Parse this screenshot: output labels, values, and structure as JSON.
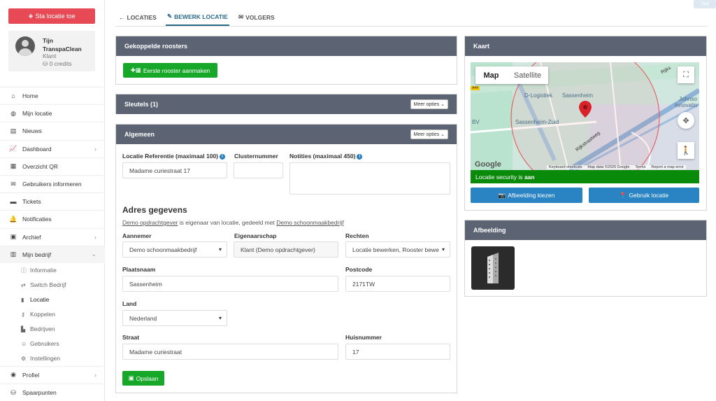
{
  "sidebar": {
    "add_button": "Sta locatie toe",
    "profile": {
      "name": "Tijn TranspaClean",
      "role": "Klant",
      "credits": "0 credits"
    },
    "items": [
      {
        "label": "Home",
        "icon": "home-icon"
      },
      {
        "label": "Mijn locatie",
        "icon": "globe-icon"
      },
      {
        "label": "Nieuws",
        "icon": "newspaper-icon"
      },
      {
        "label": "Dashboard",
        "icon": "chart-icon",
        "chevron": true
      },
      {
        "label": "Overzicht QR",
        "icon": "qr-icon"
      },
      {
        "label": "Gebruikers informeren",
        "icon": "envelope-icon"
      },
      {
        "label": "Tickets",
        "icon": "comment-icon"
      },
      {
        "label": "Notificaties",
        "icon": "bell-icon"
      },
      {
        "label": "Archief",
        "icon": "archive-icon",
        "chevron": true
      },
      {
        "label": "Mijn bedrijf",
        "icon": "building-icon",
        "chevron_down": true
      }
    ],
    "subitems": [
      {
        "label": "Informatie",
        "icon": "info-icon"
      },
      {
        "label": "Switch Bedrijf",
        "icon": "switch-icon"
      },
      {
        "label": "Locatie",
        "icon": "building-small-icon"
      },
      {
        "label": "Koppelen",
        "icon": "key-icon"
      },
      {
        "label": "Bedrijven",
        "icon": "industry-icon"
      },
      {
        "label": "Gebruikers",
        "icon": "users-icon"
      },
      {
        "label": "Instellingen",
        "icon": "cog-icon"
      }
    ],
    "bottom_items": [
      {
        "label": "Profiel",
        "icon": "user-circle-icon"
      },
      {
        "label": "Spaarpunten",
        "icon": "coins-icon"
      }
    ]
  },
  "tabs": {
    "locaties": "LOCATIES",
    "bewerk": "BEWERK LOCATIE",
    "volgers": "VOLGERS"
  },
  "topright": "Taal",
  "roosters": {
    "title": "Gekoppelde roosters",
    "button": "Eerste rooster aanmaken"
  },
  "sleutels": {
    "title": "Sleutels (1)",
    "meer": "Meer opties"
  },
  "algemeen": {
    "title": "Algemeen",
    "meer": "Meer opties",
    "ref_label": "Locatie Referentie (maximaal 100)",
    "ref_value": "Madame curiestraat 17",
    "cluster_label": "Clusternummer",
    "cluster_value": "",
    "notities_label": "Notities (maximaal 450)",
    "notities_value": "",
    "adres_title": "Adres gegevens",
    "owner_note_a": "Demo opdrachtgever",
    "owner_note_b": " is eigenaar van locatie, gedeeld met ",
    "owner_note_c": "Demo schoonmaakbedrijf",
    "aannemer_label": "Aannemer",
    "aannemer_value": "Demo schoonmaakbedrijf",
    "eigenaar_label": "Eigenaarschap",
    "eigenaar_value": "Klant (Demo opdrachtgever)",
    "rechten_label": "Rechten",
    "rechten_value": "Locatie bewerken, Rooster bewe",
    "plaats_label": "Plaatsnaam",
    "plaats_value": "Sassenheim",
    "postcode_label": "Postcode",
    "postcode_value": "2171TW",
    "land_label": "Land",
    "land_value": "Nederland",
    "straat_label": "Straat",
    "straat_value": "Madame curiestraat",
    "huis_label": "Huisnummer",
    "huis_value": "17",
    "save": "Opslaan"
  },
  "kaart": {
    "title": "Kaart",
    "map_tab": "Map",
    "sat_tab": "Satellite",
    "labels": [
      "D-Logistiek",
      "Sassenheim",
      "Sassenheim-Zuid",
      "BV",
      "Rijkstraatweg",
      "Johnso",
      "Innovatio",
      "Rijks"
    ],
    "google": "Google",
    "attribution": [
      "Keyboard shortcuts",
      "Map data ©2026 Google",
      "Terms",
      "Report a map error"
    ],
    "security_prefix": "Locatie security is ",
    "security_value": "aan",
    "btn_image": "Afbeelding kiezen",
    "btn_location": "Gebruik locatie",
    "route_badge": "A44"
  },
  "afbeelding": {
    "title": "Afbeelding"
  },
  "colors": {
    "red": "#e84a55",
    "green": "#17a82a",
    "blue": "#2a84c4",
    "header": "#5c6474",
    "security": "#0a8a0a"
  }
}
